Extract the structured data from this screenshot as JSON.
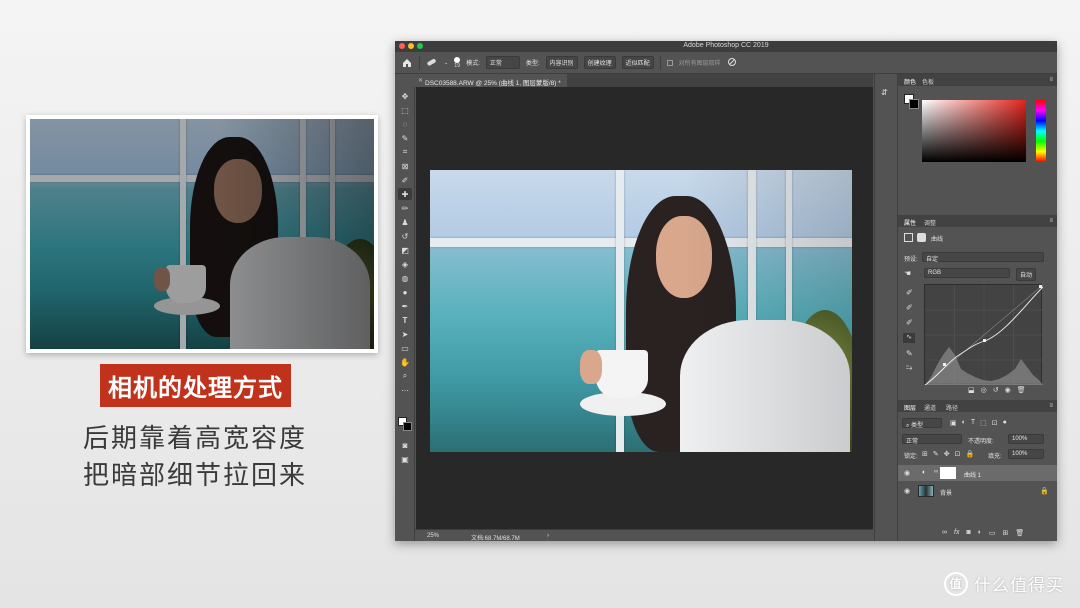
{
  "slide": {
    "caption": "相机的处理方式",
    "line1": "后期靠着高宽容度",
    "line2": "把暗部细节拉回来",
    "watermark": "什么值得买",
    "watermark_badge": "值",
    "caption_color": "#c0321c"
  },
  "photoshop": {
    "window_title": "Adobe Photoshop CC 2019",
    "options": {
      "brush_size": "19",
      "mode_label": "模式:",
      "mode_value": "正常",
      "type_label": "类型:",
      "type_buttons": [
        "内容识别",
        "创建纹理",
        "近似匹配"
      ],
      "sample_all": "对所有图层取样"
    },
    "tab_title": "DSC03588.ARW @ 25% (曲线 1, 图层蒙版/8) *",
    "status": {
      "zoom": "25%",
      "doc": "文档:68.7M/68.7M"
    },
    "color_panel": {
      "tabs": [
        "颜色",
        "色板"
      ]
    },
    "properties_panel": {
      "tabs": [
        "属性",
        "调整"
      ],
      "title": "曲线",
      "preset_label": "预设:",
      "preset_value": "自定",
      "channel": "RGB",
      "auto_button": "自动"
    },
    "layers_panel": {
      "tabs": [
        "图层",
        "通道",
        "路径"
      ],
      "filter_label": "类型",
      "blend_mode": "正常",
      "opacity_label": "不透明度:",
      "opacity_value": "100%",
      "lock_label": "锁定:",
      "fill_label": "填充:",
      "fill_value": "100%",
      "layers": [
        {
          "name": "曲线 1"
        },
        {
          "name": "背景"
        }
      ]
    }
  }
}
